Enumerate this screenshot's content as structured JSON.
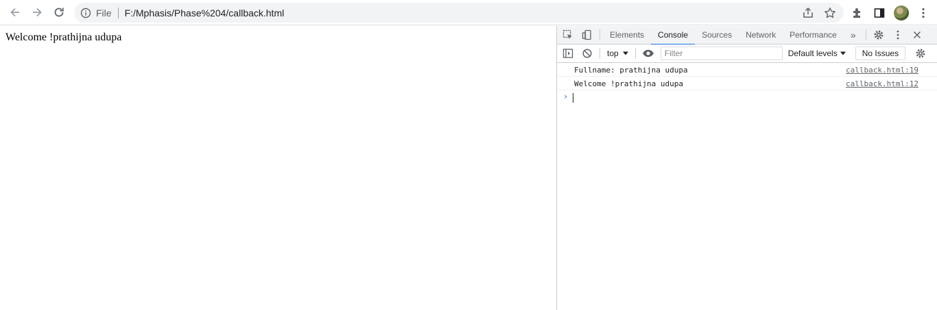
{
  "browser": {
    "address_scheme": "File",
    "address_url": "F:/Mphasis/Phase%204/callback.html"
  },
  "page": {
    "content_text": "Welcome !prathijna udupa"
  },
  "devtools": {
    "tabs": [
      "Elements",
      "Console",
      "Sources",
      "Network",
      "Performance"
    ],
    "active_tab": "Console",
    "console_bar": {
      "context": "top",
      "filter_placeholder": "Filter",
      "levels": "Default levels",
      "issues": "No Issues"
    },
    "logs": [
      {
        "message": "Fullname: prathijna udupa",
        "source": "callback.html:19"
      },
      {
        "message": "Welcome !prathijna udupa",
        "source": "callback.html:12"
      }
    ]
  },
  "colors": {
    "accent": "#1a73e8",
    "toolbar_bg": "#ffffff",
    "omnibox_bg": "#f1f3f4",
    "devtools_tab_bg": "#f1f3f4"
  }
}
